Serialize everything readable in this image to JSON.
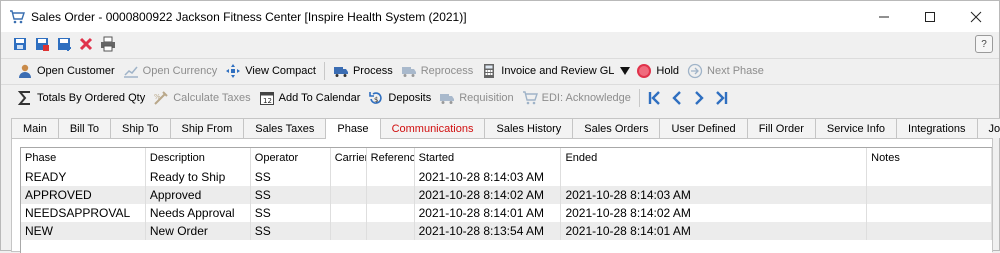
{
  "window": {
    "title": "Sales Order - 0000800922 Jackson Fitness Center [Inspire Health System (2021)]"
  },
  "toolbar2": {
    "open_customer": "Open Customer",
    "open_currency": "Open Currency",
    "view_compact": "View Compact",
    "process": "Process",
    "reprocess": "Reprocess",
    "invoice_review": "Invoice and Review GL",
    "hold": "Hold",
    "next_phase": "Next Phase"
  },
  "toolbar3": {
    "totals": "Totals By Ordered Qty",
    "calculate_taxes": "Calculate Taxes",
    "add_calendar": "Add To Calendar",
    "deposits": "Deposits",
    "requisition": "Requisition",
    "edi_ack": "EDI: Acknowledge"
  },
  "tabs": [
    "Main",
    "Bill To",
    "Ship To",
    "Ship From",
    "Sales Taxes",
    "Phase",
    "Communications",
    "Sales History",
    "Sales Orders",
    "User Defined",
    "Fill Order",
    "Service Info",
    "Integrations",
    "Job"
  ],
  "grid": {
    "headers": [
      "Phase",
      "Description",
      "Operator",
      "Carrier",
      "Reference",
      "Started",
      "Ended",
      "Notes"
    ],
    "rows": [
      [
        "READY",
        "Ready to Ship",
        "SS",
        "",
        "",
        "2021-10-28 8:14:03 AM",
        "",
        ""
      ],
      [
        "APPROVED",
        "Approved",
        "SS",
        "",
        "",
        "2021-10-28 8:14:02 AM",
        "2021-10-28 8:14:03 AM",
        ""
      ],
      [
        "NEEDSAPPROVAL",
        "Needs Approval",
        "SS",
        "",
        "",
        "2021-10-28 8:14:01 AM",
        "2021-10-28 8:14:02 AM",
        ""
      ],
      [
        "NEW",
        "New Order",
        "SS",
        "",
        "",
        "2021-10-28 8:13:54 AM",
        "2021-10-28 8:14:01 AM",
        ""
      ]
    ]
  },
  "colors": {
    "accent_blue": "#2f6fc0",
    "hold_red": "#e0334b",
    "tab_red": "#d10f0f"
  }
}
